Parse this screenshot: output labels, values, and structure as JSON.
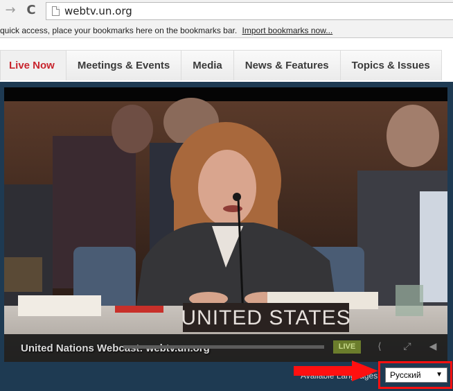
{
  "browser": {
    "url": "webtv.un.org",
    "icons": {
      "back": "back-arrow-icon",
      "reload": "reload-icon",
      "page": "page-icon"
    }
  },
  "bookmarks_bar": {
    "message": "quick access, place your bookmarks here on the bookmarks bar.",
    "import_link": "Import bookmarks now..."
  },
  "tabs": [
    {
      "label": "Live Now",
      "active": true
    },
    {
      "label": "Meetings & Events",
      "active": false
    },
    {
      "label": "Media",
      "active": false
    },
    {
      "label": "News & Features",
      "active": false
    },
    {
      "label": "Topics & Issues",
      "active": false
    }
  ],
  "player": {
    "nameplate": "UNITED STATES",
    "watermark": "United Nations Webcast: webtv.un.org",
    "live_label": "LIVE",
    "icons": [
      "share-icon",
      "fullscreen-icon",
      "volume-icon"
    ]
  },
  "language": {
    "label": "Available Languages:",
    "selected": "Русский"
  },
  "colors": {
    "active_tab": "#c8242d",
    "player_frame": "#1e3a52",
    "annotation": "#ff1010",
    "live_badge": "#6b7d2c"
  }
}
